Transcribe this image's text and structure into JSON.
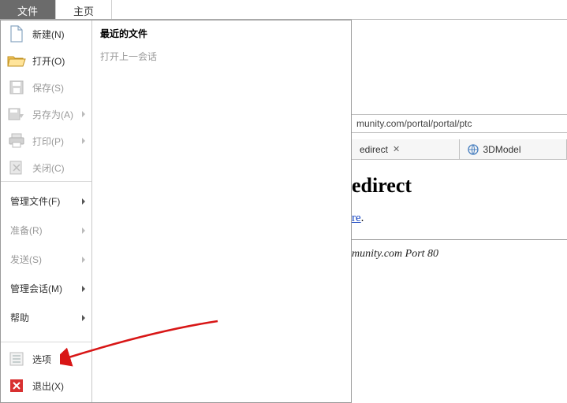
{
  "tabs": {
    "file": "文件",
    "home": "主页"
  },
  "menu": {
    "new": "新建(N)",
    "open": "打开(O)",
    "save": "保存(S)",
    "saveAs": "另存为(A)",
    "print": "打印(P)",
    "close": "关闭(C)",
    "manageFiles": "管理文件(F)",
    "prepare": "准备(R)",
    "send": "发送(S)",
    "manageSessions": "管理会话(M)",
    "help": "帮助",
    "options": "选项",
    "exit": "退出(X)"
  },
  "recent": {
    "title": "最近的文件",
    "openLastSession": "打开上一会话"
  },
  "browser": {
    "address": "munity.com/portal/portal/ptc",
    "tab1": "edirect",
    "tab2": "3DModel",
    "heading": "edirect",
    "linkFragment": "re",
    "linkSuffix": ".",
    "footer": "munity.com Port 80"
  }
}
